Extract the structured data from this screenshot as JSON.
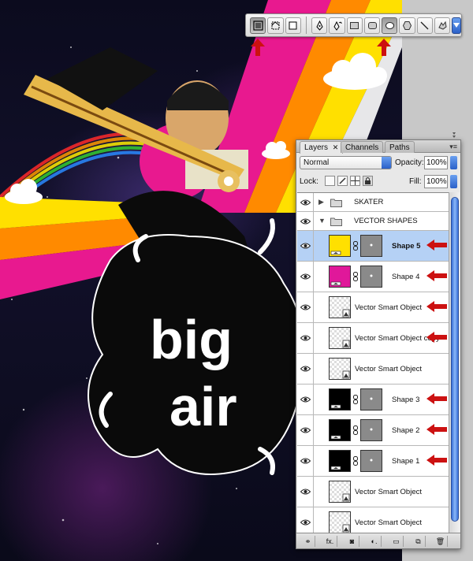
{
  "toolbar": {
    "mode_buttons": [
      {
        "icon": "shape-layers-icon",
        "active": true
      },
      {
        "icon": "paths-icon",
        "active": false
      },
      {
        "icon": "fill-pixels-icon",
        "active": false
      }
    ],
    "tool_buttons": [
      {
        "icon": "pen-tool-icon",
        "active": false
      },
      {
        "icon": "freeform-pen-icon",
        "active": false
      },
      {
        "icon": "rectangle-tool-icon",
        "active": false
      },
      {
        "icon": "rounded-rectangle-tool-icon",
        "active": false
      },
      {
        "icon": "ellipse-tool-icon",
        "active": true
      },
      {
        "icon": "polygon-tool-icon",
        "active": false
      },
      {
        "icon": "line-tool-icon",
        "active": false
      },
      {
        "icon": "custom-shape-tool-icon",
        "active": false
      }
    ],
    "arrow_color": "#cc1111"
  },
  "layers_panel": {
    "tabs": [
      {
        "label": "Layers",
        "active": true
      },
      {
        "label": "Channels",
        "active": false
      },
      {
        "label": "Paths",
        "active": false
      }
    ],
    "blend_mode": "Normal",
    "opacity_label": "Opacity:",
    "opacity_value": "100%",
    "lock_label": "Lock:",
    "fill_label": "Fill:",
    "fill_value": "100%",
    "layers": [
      {
        "name": "SKATER",
        "kind": "group",
        "expanded": false,
        "bold": false
      },
      {
        "name": "VECTOR SHAPES",
        "kind": "group",
        "expanded": true,
        "bold": false
      },
      {
        "name": "Shape 5",
        "kind": "shape",
        "color": "#ffe000",
        "selected": true,
        "bold": true,
        "arrow": true
      },
      {
        "name": "Shape 4",
        "kind": "shape",
        "color": "#e0189a",
        "selected": false,
        "bold": false,
        "arrow": true
      },
      {
        "name": "Vector Smart Object",
        "kind": "smart",
        "selected": false,
        "bold": false,
        "arrow": true
      },
      {
        "name": "Vector Smart Object copy",
        "kind": "smart",
        "selected": false,
        "bold": false,
        "arrow": true
      },
      {
        "name": "Vector Smart Object",
        "kind": "smart",
        "selected": false,
        "bold": false,
        "arrow": false
      },
      {
        "name": "Shape 3",
        "kind": "shape",
        "color": "#000000",
        "selected": false,
        "bold": false,
        "arrow": true
      },
      {
        "name": "Shape 2",
        "kind": "shape",
        "color": "#000000",
        "selected": false,
        "bold": false,
        "arrow": true
      },
      {
        "name": "Shape 1",
        "kind": "shape",
        "color": "#000000",
        "selected": false,
        "bold": false,
        "arrow": true
      },
      {
        "name": "Vector Smart Object",
        "kind": "smart",
        "selected": false,
        "bold": false,
        "arrow": false
      },
      {
        "name": "Vector Smart Object",
        "kind": "smart",
        "selected": false,
        "bold": false,
        "arrow": false
      }
    ],
    "footer_buttons": [
      {
        "icon": "link-layers-icon",
        "label": "⚭"
      },
      {
        "icon": "layer-style-icon",
        "label": "fx."
      },
      {
        "icon": "add-mask-icon",
        "label": "◙"
      },
      {
        "icon": "adjustment-layer-icon",
        "label": "◐."
      },
      {
        "icon": "new-group-icon",
        "label": "▭"
      },
      {
        "icon": "new-layer-icon",
        "label": "⧉"
      },
      {
        "icon": "delete-layer-icon",
        "label": "🗑"
      }
    ]
  },
  "artwork": {
    "rainbow_colors": [
      "#e8198f",
      "#ff8a00",
      "#ffe000",
      "#ffffff"
    ],
    "background": "#0b0b1e"
  }
}
